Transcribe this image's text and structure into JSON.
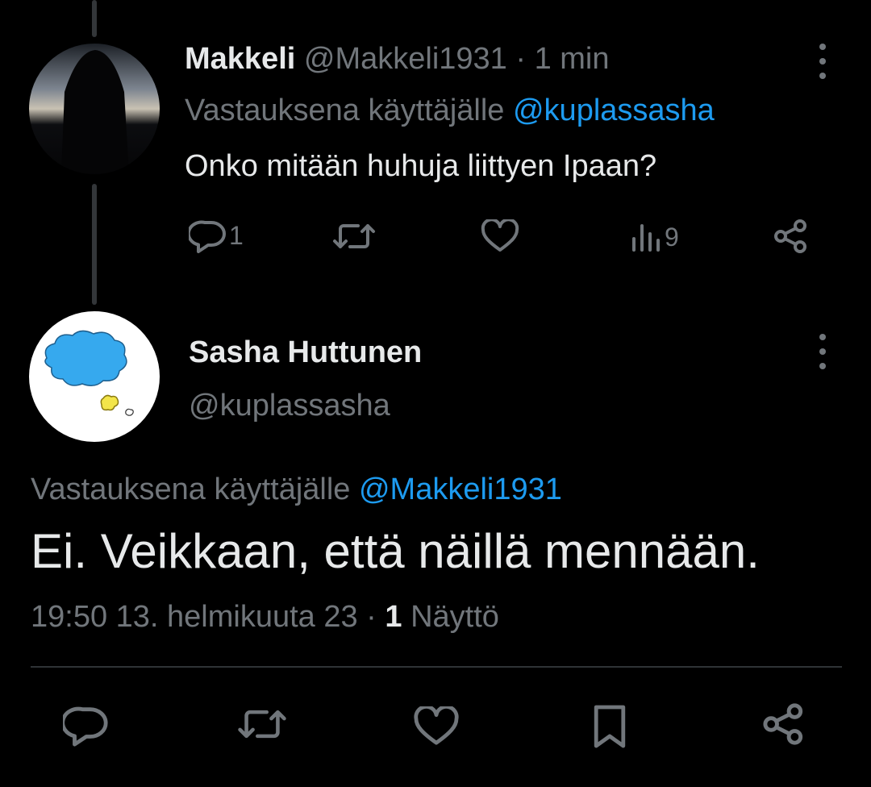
{
  "tweet1": {
    "author_name": "Makkeli",
    "author_handle": "@Makkeli1931",
    "separator": " · ",
    "time": "1 min",
    "reply_prefix": "Vastauksena käyttäjälle ",
    "reply_to": "@kuplassasha",
    "text": "Onko mitään huhuja liittyen Ipaan?",
    "actions": {
      "reply_count": "1",
      "views_count": "9"
    }
  },
  "tweet2": {
    "author_name": "Sasha Huttunen",
    "author_handle": "@kuplassasha",
    "reply_prefix": "Vastauksena käyttäjälle ",
    "reply_to": "@Makkeli1931",
    "text": "Ei. Veikkaan, että näillä mennään.",
    "timestamp": "19:50 13. helmikuuta 23",
    "separator": " · ",
    "views_count": "1",
    "views_label": " Näyttö"
  },
  "icons": {
    "reply": "reply-icon",
    "retweet": "retweet-icon",
    "like": "heart-icon",
    "views": "views-icon",
    "share": "share-icon",
    "bookmark": "bookmark-icon",
    "more": "more-icon"
  },
  "colors": {
    "background": "#000000",
    "text": "#e7e9ea",
    "muted": "#71767b",
    "accent": "#1d9bf0",
    "divider": "#2f3336"
  }
}
